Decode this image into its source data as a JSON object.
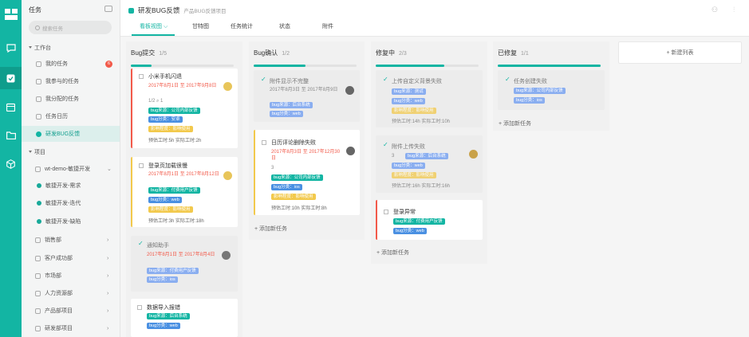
{
  "sidebar": {
    "title": "任务",
    "search_placeholder": "搜索任务",
    "workbench_label": "工作台",
    "work_items": [
      {
        "label": "我的任务",
        "badge": "6"
      },
      {
        "label": "我参与的任务"
      },
      {
        "label": "我分配的任务"
      },
      {
        "label": "任务日历"
      },
      {
        "label": "研发BUG反馈"
      }
    ],
    "projects_label": "项目",
    "projects": [
      {
        "label": "wt-demo-敏捷开发"
      },
      {
        "label": "敏捷开发-需求"
      },
      {
        "label": "敏捷开发-迭代"
      },
      {
        "label": "敏捷开发-缺陷"
      },
      {
        "label": "销售部"
      },
      {
        "label": "客户成功部"
      },
      {
        "label": "市场部"
      },
      {
        "label": "人力资源部"
      },
      {
        "label": "产品部项目"
      },
      {
        "label": "研发部项目"
      }
    ]
  },
  "header": {
    "project_title": "研发BUG反馈",
    "project_subtitle": "产品BUG反馈项目",
    "tabs": [
      "看板视图",
      "甘特图",
      "任务统计",
      "状态",
      "附件"
    ],
    "active_tab": "看板视图",
    "dropdown_glyph": "⌵"
  },
  "board": {
    "add_task_label": "+ 添加新任务",
    "new_list_label": "+ 新建列表",
    "columns": [
      {
        "name": "Bug提交",
        "count": "1/5",
        "progress": 0.2,
        "cards": [
          {
            "title": "小米手机闪退",
            "date": "2017年8月1日 至 2017年9月8日",
            "meta": "1/2  ⌕ 1",
            "tags": [
              "bug来源：公司内部反馈",
              "bug分类：安卓",
              "影响程度：影响使用"
            ],
            "est": "预估工时:5h  实际工时:2h"
          },
          {
            "title": "登录页加载很慢",
            "date": "2017年8月1日 至 2017年8月12日",
            "tags": [
              "bug来源：付费用户反馈",
              "bug分类：web",
              "影响程度：影响使用"
            ],
            "est": "预估工时:3h  实际工时:18h"
          },
          {
            "title": "通知助手",
            "date": "2017年8月1日 至 2017年8月4日",
            "tags": [
              "bug来源：付费用户反馈",
              "bug分类：ios"
            ]
          },
          {
            "title": "数据导入报错",
            "tags": [
              "bug来源：后台系统",
              "bug分类：web"
            ]
          }
        ]
      },
      {
        "name": "Bug确认",
        "count": "1/2",
        "progress": 0.5,
        "cards": [
          {
            "title": "附件显示不完整",
            "date": "2017年8月3日 至 2017年8月9日",
            "tags": [
              "bug来源：后台系统",
              "bug分类：web"
            ]
          },
          {
            "title": "日历评论删除失败",
            "date": "2017年8月3日 至 2017年12月30日",
            "meta": "3",
            "tags": [
              "bug来源：公司内部反馈",
              "bug分类：ios",
              "影响程度：影响使用"
            ],
            "est": "预估工时:10h  实际工时:8h"
          }
        ]
      },
      {
        "name": "修复中",
        "count": "2/3",
        "progress": 0.67,
        "cards": [
          {
            "title": "上传自定义背景失败",
            "tags": [
              "bug来源：测试",
              "bug分类：web",
              "影响程度：影响使用"
            ],
            "est": "预估工时:14h  实际工时:10h"
          },
          {
            "title": "附件上传失败",
            "meta": "3",
            "tags": [
              "bug来源：后台系统",
              "bug分类：web",
              "影响程度：影响使用"
            ],
            "est": "预估工时:16h  实际工时:16h"
          },
          {
            "title": "登录异常",
            "tags": [
              "bug来源：付费用户反馈",
              "bug分类：web"
            ]
          }
        ]
      },
      {
        "name": "已修复",
        "count": "1/1",
        "progress": 1,
        "cards": [
          {
            "title": "任务创建失败",
            "tags": [
              "bug来源：公司内部反馈",
              "bug分类：ios"
            ]
          }
        ]
      }
    ]
  },
  "colors": {
    "accent": "#13b5a3",
    "overdue": "#f25a4a",
    "tag_blue": "#4a90e2",
    "tag_yellow": "#f2c94c"
  }
}
